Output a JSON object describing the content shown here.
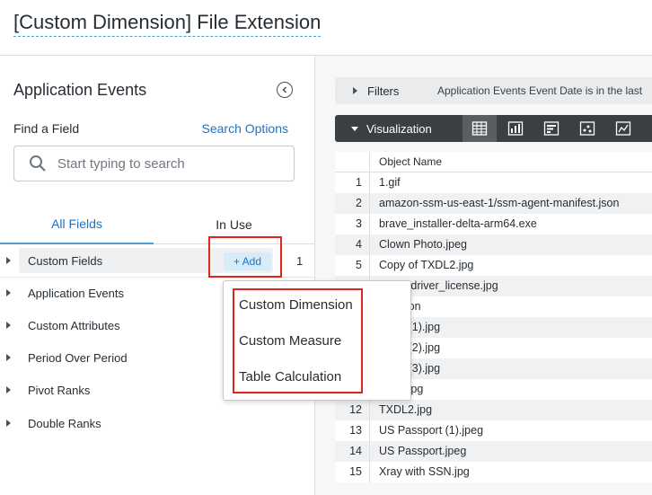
{
  "header": {
    "title": "[Custom Dimension] File Extension"
  },
  "sidebar": {
    "title": "Application Events",
    "find_label": "Find a Field",
    "search_options_label": "Search Options",
    "search_placeholder": "Start typing to search",
    "tabs": [
      {
        "label": "All Fields"
      },
      {
        "label": "In Use"
      }
    ],
    "groups": [
      {
        "label": "Custom Fields"
      },
      {
        "label": "Application Events"
      },
      {
        "label": "Custom Attributes"
      },
      {
        "label": "Period Over Period"
      },
      {
        "label": "Pivot Ranks"
      },
      {
        "label": "Double Ranks"
      }
    ],
    "add_button_label": "+ Add",
    "add_count": "1"
  },
  "add_menu": {
    "items": [
      {
        "label": "Custom Dimension"
      },
      {
        "label": "Custom Measure"
      },
      {
        "label": "Table Calculation"
      }
    ]
  },
  "main": {
    "filters": {
      "label": "Filters",
      "description": "Application Events Event Date is in the last"
    },
    "visualization": {
      "label": "Visualization",
      "icons": [
        "table-icon",
        "bar-chart-icon",
        "row-chart-icon",
        "scatter-icon",
        "line-chart-icon"
      ]
    },
    "table": {
      "column_header": "Object Name",
      "rows": [
        {
          "num": "1",
          "name": "1.gif"
        },
        {
          "num": "2",
          "name": "amazon-ssm-us-east-1/ssm-agent-manifest.json"
        },
        {
          "num": "3",
          "name": "brave_installer-delta-arm64.exe"
        },
        {
          "num": "4",
          "name": "Clown Photo.jpeg"
        },
        {
          "num": "5",
          "name": "Copy of TXDL2.jpg"
        },
        {
          "num": "",
          "name": "le-US-driver_license.jpg"
        },
        {
          "num": "",
          "name": "test.json"
        },
        {
          "num": "",
          "name": "ay ID (1).jpg"
        },
        {
          "num": "",
          "name": "ay ID (2).jpg"
        },
        {
          "num": "",
          "name": "ay ID (3).jpg"
        },
        {
          "num": "",
          "name": "ay ID.jpg"
        },
        {
          "num": "12",
          "name": "TXDL2.jpg"
        },
        {
          "num": "13",
          "name": "US Passport (1).jpeg"
        },
        {
          "num": "14",
          "name": "US Passport.jpeg"
        },
        {
          "num": "15",
          "name": "Xray with SSN.jpg"
        }
      ]
    }
  }
}
